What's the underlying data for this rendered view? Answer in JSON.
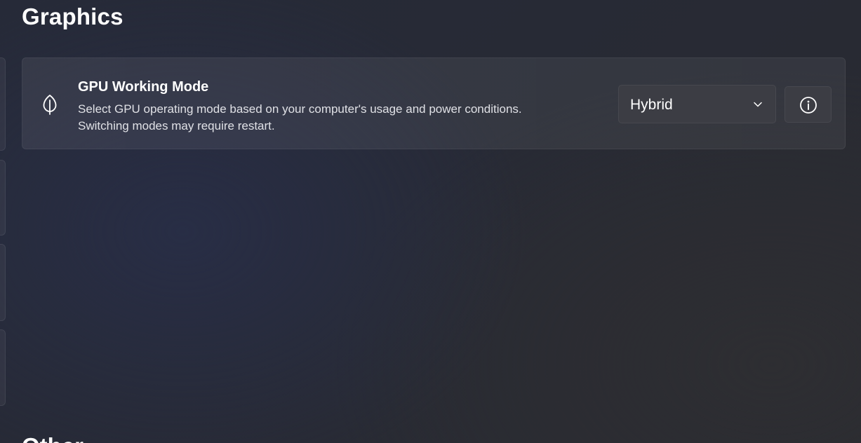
{
  "page": {
    "title": "Graphics",
    "next_section_title": "Other"
  },
  "gpu_setting": {
    "icon": "leaf-icon",
    "title": "GPU Working Mode",
    "description_line1": "Select GPU operating mode based on your computer's usage and power conditions.",
    "description_line2": "Switching modes may require restart.",
    "selected_mode": "Hybrid",
    "dropdown_icon": "chevron-down-icon",
    "info_icon": "info-icon"
  },
  "colors": {
    "background": "#272a35",
    "card": "#34363e",
    "control": "#3c3d44",
    "text_primary": "#ffffff",
    "text_secondary": "#e0e1e6"
  }
}
